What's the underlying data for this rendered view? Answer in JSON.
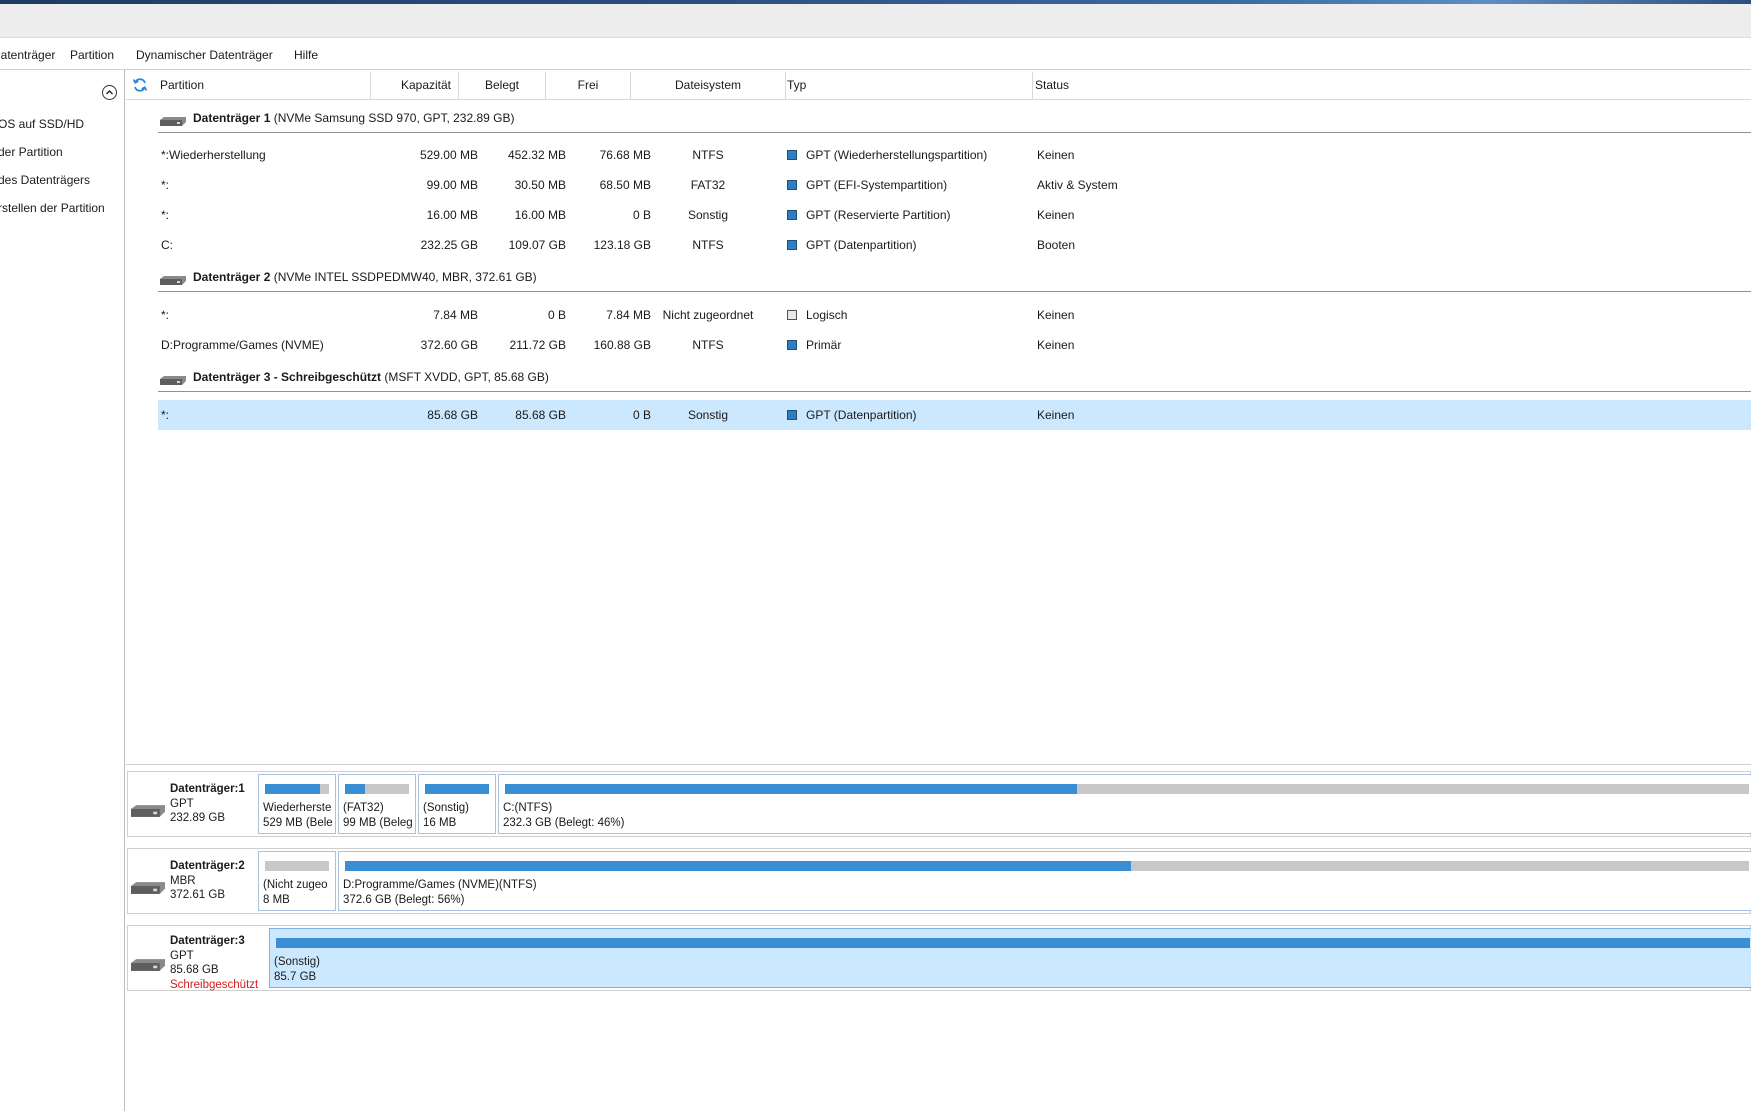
{
  "menu": [
    "Datenträger",
    "Partition",
    "Dynamischer Datenträger",
    "Hilfe"
  ],
  "sidebar": {
    "items": [
      "OS auf SSD/HD",
      "der Partition",
      "des Datenträgers",
      "rstellen der Partition"
    ]
  },
  "columns": [
    "Partition",
    "Kapazität",
    "Belegt",
    "Frei",
    "Dateisystem",
    "Typ",
    "Status"
  ],
  "disks": [
    {
      "title": "Datenträger 1",
      "details": "(NVMe Samsung SSD 970, GPT, 232.89 GB)",
      "partitions": [
        {
          "name": "*:Wiederherstellung",
          "capacity": "529.00 MB",
          "used": "452.32 MB",
          "free": "76.68 MB",
          "fs": "NTFS",
          "type": "GPT (Wiederherstellungspartition)",
          "type_color": "blue",
          "status": "Keinen"
        },
        {
          "name": "*:",
          "capacity": "99.00 MB",
          "used": "30.50 MB",
          "free": "68.50 MB",
          "fs": "FAT32",
          "type": "GPT (EFI-Systempartition)",
          "type_color": "blue",
          "status": "Aktiv & System"
        },
        {
          "name": "*:",
          "capacity": "16.00 MB",
          "used": "16.00 MB",
          "free": "0 B",
          "fs": "Sonstig",
          "type": "GPT (Reservierte Partition)",
          "type_color": "blue",
          "status": "Keinen"
        },
        {
          "name": "C:",
          "capacity": "232.25 GB",
          "used": "109.07 GB",
          "free": "123.18 GB",
          "fs": "NTFS",
          "type": "GPT (Datenpartition)",
          "type_color": "blue",
          "status": "Booten"
        }
      ]
    },
    {
      "title": "Datenträger 2",
      "details": "(NVMe INTEL SSDPEDMW40, MBR, 372.61 GB)",
      "partitions": [
        {
          "name": "*:",
          "capacity": "7.84 MB",
          "used": "0 B",
          "free": "7.84 MB",
          "fs": "Nicht zugeordnet",
          "type": "Logisch",
          "type_color": "gray",
          "status": "Keinen"
        },
        {
          "name": "D:Programme/Games (NVME)",
          "capacity": "372.60 GB",
          "used": "211.72 GB",
          "free": "160.88 GB",
          "fs": "NTFS",
          "type": "Primär",
          "type_color": "blue",
          "status": "Keinen"
        }
      ]
    },
    {
      "title": "Datenträger 3 - Schreibgeschützt",
      "details": "(MSFT XVDD, GPT, 85.68 GB)",
      "partitions": [
        {
          "name": "*:",
          "capacity": "85.68 GB",
          "used": "85.68 GB",
          "free": "0 B",
          "fs": "Sonstig",
          "type": "GPT (Datenpartition)",
          "type_color": "blue",
          "status": "Keinen"
        }
      ]
    }
  ],
  "map": [
    {
      "name": "Datenträger:1",
      "style": "GPT",
      "size": "232.89 GB",
      "parts": [
        {
          "line1": "Wiederherste",
          "line2": "529 MB (Bele",
          "used_fraction": 0.86
        },
        {
          "line1": "(FAT32)",
          "line2": "99 MB (Beleg",
          "used_fraction": 0.31
        },
        {
          "line1": "(Sonstig)",
          "line2": "16 MB",
          "used_fraction": 1.0
        },
        {
          "line1": "C:(NTFS)",
          "line2": "232.3 GB (Belegt: 46%)",
          "used_fraction": 0.46
        }
      ]
    },
    {
      "name": "Datenträger:2",
      "style": "MBR",
      "size": "372.61 GB",
      "parts": [
        {
          "line1": "(Nicht zugeo",
          "line2": "8 MB",
          "used_fraction": 0.0
        },
        {
          "line1": "D:Programme/Games (NVME)(NTFS)",
          "line2": "372.6 GB (Belegt: 56%)",
          "used_fraction": 0.56
        }
      ]
    },
    {
      "name": "Datenträger:3",
      "style": "GPT",
      "size": "85.68 GB",
      "flag": "Schreibgeschützt",
      "parts": [
        {
          "line1": "(Sonstig)",
          "line2": "85.7 GB",
          "used_fraction": 1.0
        }
      ]
    }
  ],
  "colors": {
    "accent": "#3a8ed3",
    "selection": "#cce8ff",
    "warning": "#d21f1f"
  }
}
